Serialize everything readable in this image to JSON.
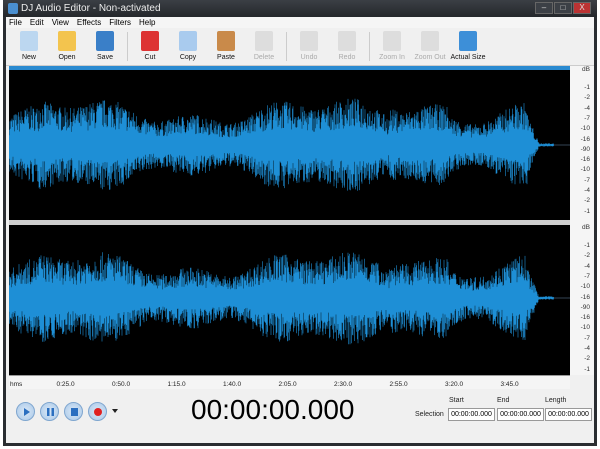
{
  "window": {
    "title": "DJ Audio Editor - Non-activated",
    "controls": [
      "–",
      "□",
      "X"
    ]
  },
  "menu": [
    "File",
    "Edit",
    "View",
    "Effects",
    "Filters",
    "Help"
  ],
  "toolbar": [
    {
      "label": "New",
      "icon": "new-file-icon",
      "enabled": true,
      "color": "#bcd7f0"
    },
    {
      "label": "Open",
      "icon": "folder-icon",
      "enabled": true,
      "color": "#f3c44e"
    },
    {
      "label": "Save",
      "icon": "floppy-icon",
      "enabled": true,
      "color": "#3a7fc8"
    },
    {
      "label": "Cut",
      "icon": "scissors-icon",
      "enabled": true,
      "color": "#d33"
    },
    {
      "label": "Copy",
      "icon": "copy-icon",
      "enabled": true,
      "color": "#a9cbee"
    },
    {
      "label": "Paste",
      "icon": "paste-icon",
      "enabled": true,
      "color": "#c98a4a"
    },
    {
      "label": "Delete",
      "icon": "delete-icon",
      "enabled": false,
      "color": "#ddd"
    },
    {
      "label": "Undo",
      "icon": "undo-icon",
      "enabled": false,
      "color": "#ddd"
    },
    {
      "label": "Redo",
      "icon": "redo-icon",
      "enabled": false,
      "color": "#ddd"
    },
    {
      "label": "Zoom In",
      "icon": "zoom-in-icon",
      "enabled": false,
      "color": "#ddd"
    },
    {
      "label": "Zoom Out",
      "icon": "zoom-out-icon",
      "enabled": false,
      "color": "#ddd"
    },
    {
      "label": "Actual Size",
      "icon": "actual-size-icon",
      "enabled": true,
      "color": "#3d8fd8"
    }
  ],
  "scale": {
    "unit": "dB",
    "labels": [
      "-1",
      "-2",
      "-4",
      "-7",
      "-10",
      "-16",
      "-90",
      "-16",
      "-10",
      "-7",
      "-4",
      "-2",
      "-1"
    ]
  },
  "ruler": [
    "hms",
    "0:25.0",
    "0:50.0",
    "1:15.0",
    "1:40.0",
    "2:05.0",
    "2:30.0",
    "2:55.0",
    "3:20.0",
    "3:45.0"
  ],
  "waveform_color": "#1e8fd6",
  "transport": {
    "time": "00:00:00.000"
  },
  "selection": {
    "label": "Selection",
    "start_label": "Start",
    "end_label": "End",
    "length_label": "Length",
    "start": "00:00:00.000",
    "end": "00:00:00.000",
    "length": "00:00:00.000"
  }
}
